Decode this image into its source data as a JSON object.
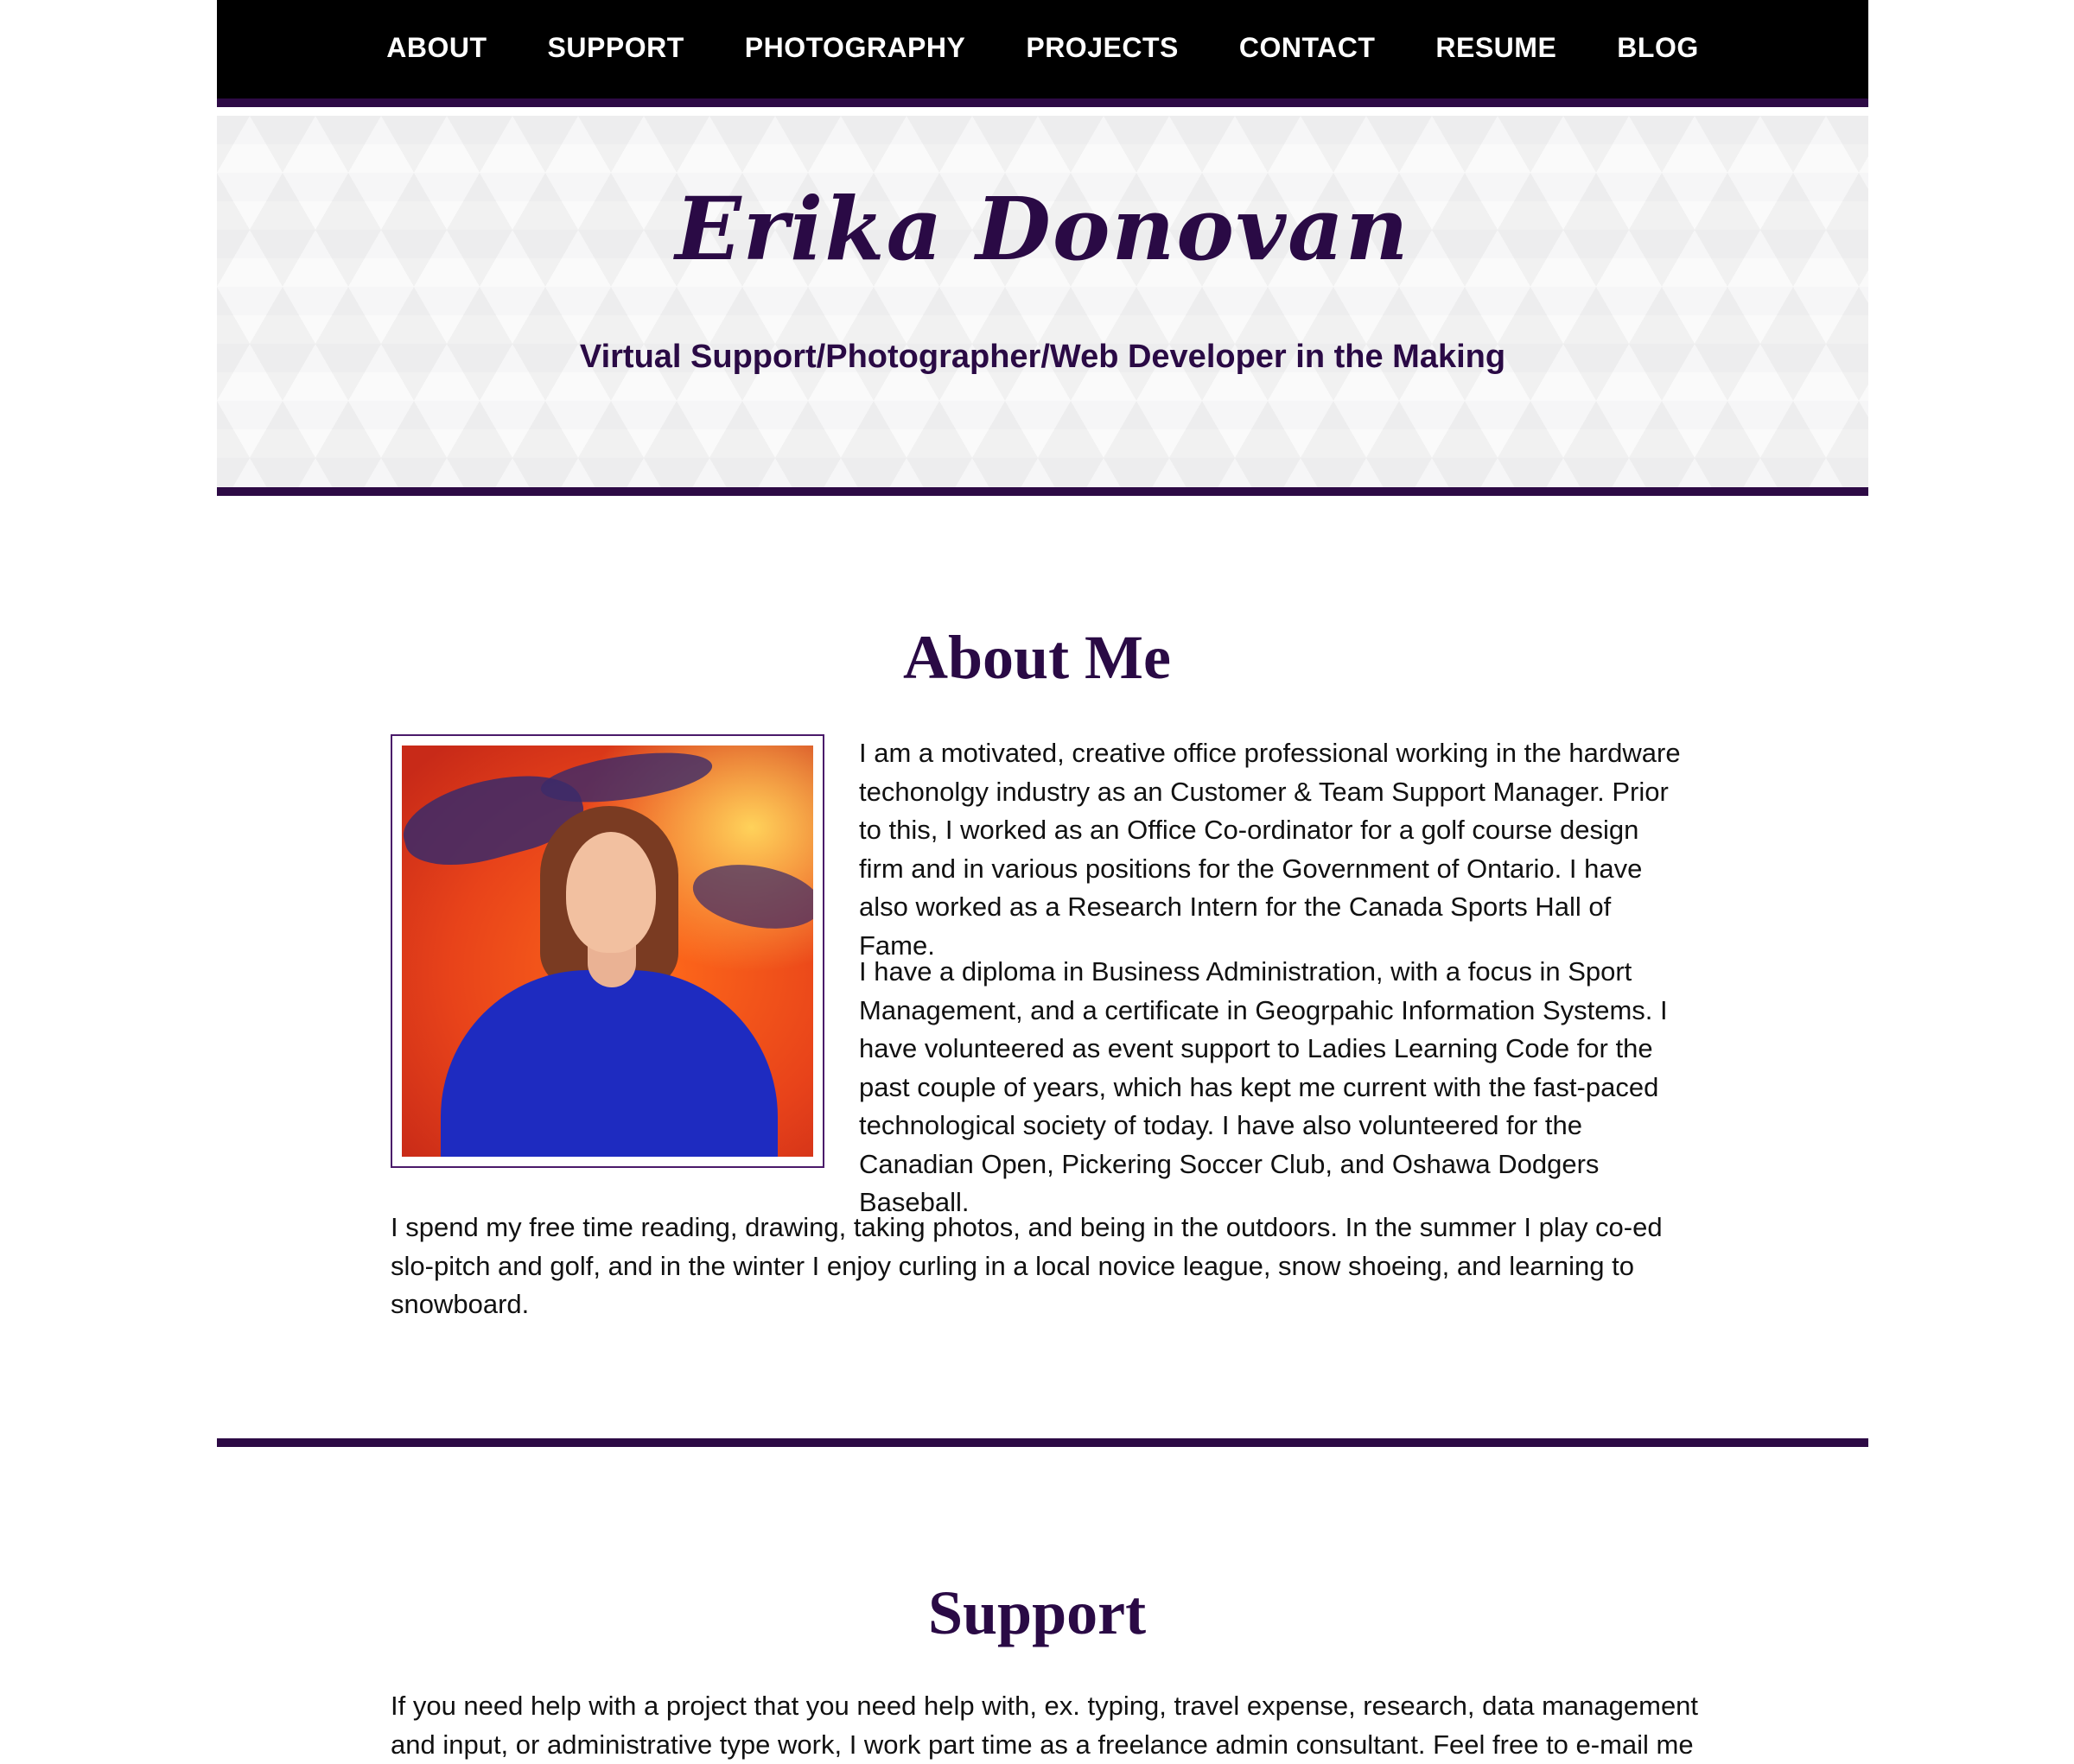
{
  "nav": {
    "items": [
      "ABOUT",
      "SUPPORT",
      "PHOTOGRAPHY",
      "PROJECTS",
      "CONTACT",
      "RESUME",
      "BLOG"
    ]
  },
  "hero": {
    "name": "Erika Donovan",
    "tagline": "Virtual Support/Photographer/Web Developer in the Making"
  },
  "about": {
    "title": "About Me",
    "paragraphs": [
      "I am a motivated, creative office professional working in the hardware techonolgy industry as an Customer & Team Support Manager. Prior to this, I worked as an Office Co-ordinator for a golf course design firm and in various positions for the Government of Ontario. I have also worked as a Research Intern for the Canada Sports Hall of Fame.",
      "I have a diploma in Business Administration, with a focus in Sport Management, and a certificate in Geogrpahic Information Systems. I have volunteered as event support to Ladies Learning Code for the past couple of years, which has kept me current with the fast-paced technological society of today. I have also volunteered for the Canadian Open, Pickering Soccer Club, and Oshawa Dodgers Baseball.",
      "I spend my free time reading, drawing, taking photos, and being in the outdoors. In the summer I play co-ed slo-pitch and golf, and in the winter I enjoy curling in a local novice league, snow shoeing, and learning to snowboard."
    ]
  },
  "support": {
    "title": "Support",
    "paragraph": "If you need help with a project that you need help with, ex. typing, travel expense, research, data management and input, or administrative type work, I work part time as a freelance admin consultant. Feel free to e-mail me"
  },
  "colors": {
    "accent": "#2d0a45",
    "nav_bg": "#000000",
    "hero_bg": "#f6f6f7"
  }
}
